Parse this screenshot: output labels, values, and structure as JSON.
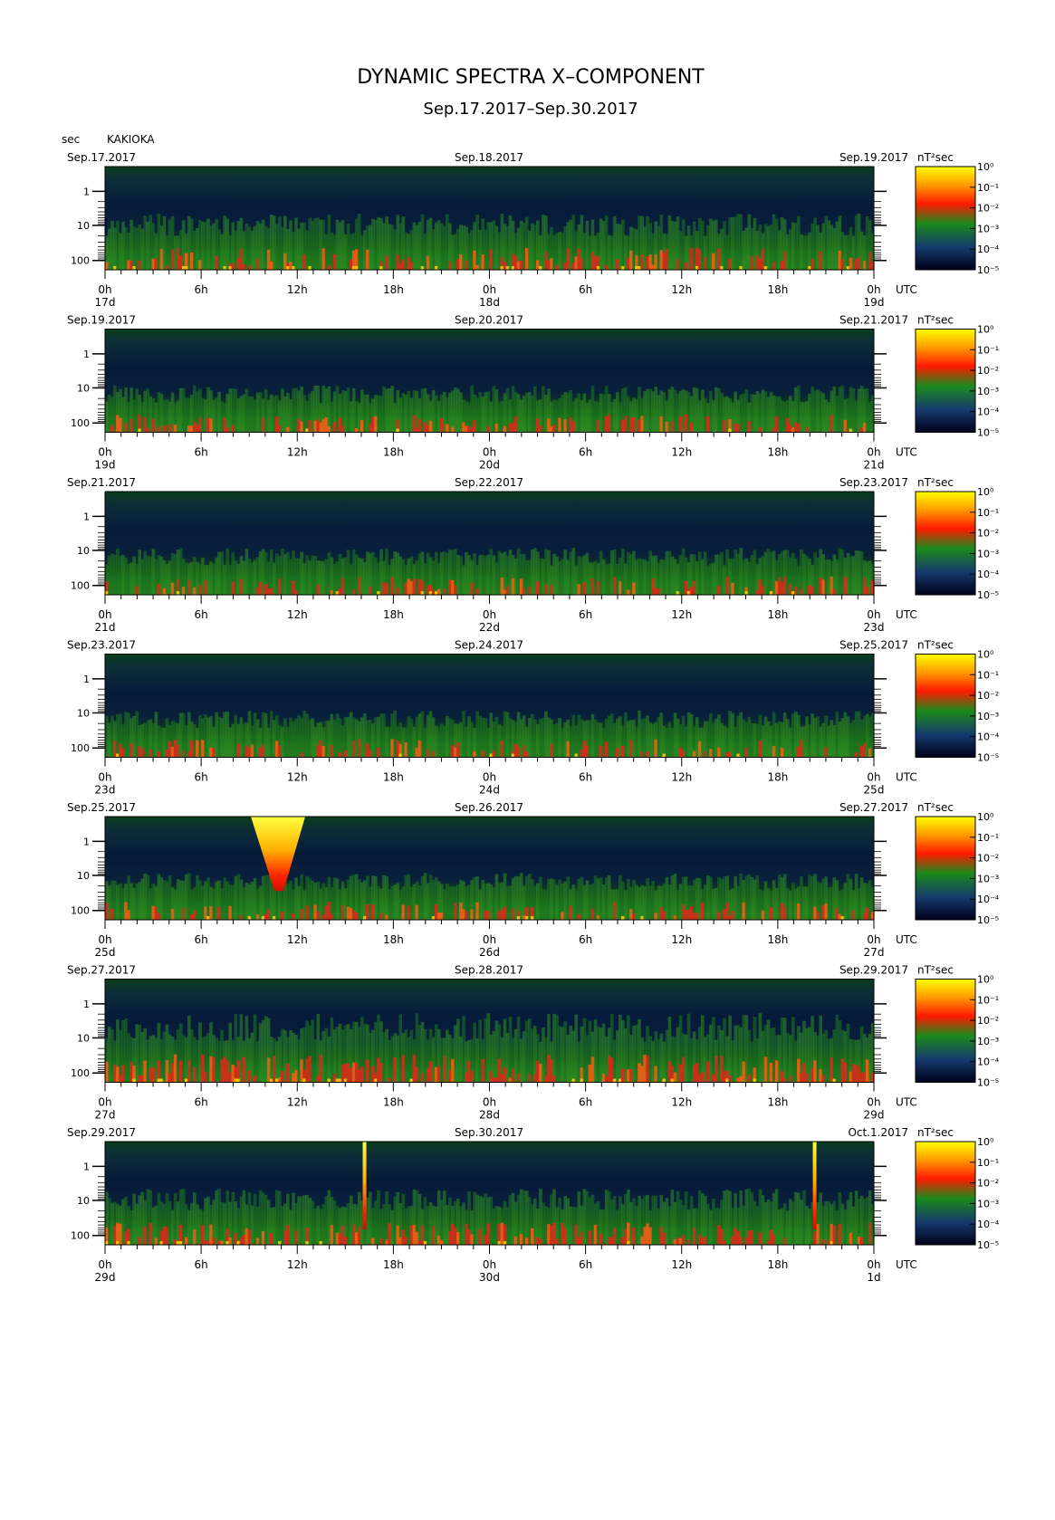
{
  "figure": {
    "title": "DYNAMIC SPECTRA X–COMPONENT",
    "subtitle": "Sep.17.2017–Sep.30.2017",
    "y_unit": "sec",
    "station": "KAKIOKA",
    "colorbar_unit": "nT²sec",
    "time_label": "UTC"
  },
  "chart_data": {
    "type": "heatmap",
    "title": "DYNAMIC SPECTRA X–COMPONENT",
    "subtitle": "Sep.17.2017–Sep.30.2017",
    "ylabel": "sec",
    "y_scale": "log",
    "y_ticks": [
      "1",
      "10",
      "100"
    ],
    "x_tick_labels": [
      "0h",
      "6h",
      "12h",
      "18h",
      "0h",
      "6h",
      "12h",
      "18h",
      "0h"
    ],
    "colorbar": {
      "unit": "nT²sec",
      "ticks": [
        "10⁰",
        "10⁻¹",
        "10⁻²",
        "10⁻³",
        "10⁻⁴",
        "10⁻⁵"
      ],
      "colors": [
        "#ffff00",
        "#ff9900",
        "#ff1a00",
        "#1b8a1b",
        "#153a6e",
        "#00001a"
      ]
    },
    "panels": [
      {
        "left_date": "Sep.17.2017",
        "mid_date": "Sep.18.2017",
        "right_date": "Sep.19.2017",
        "day_labels": [
          "17d",
          "18d",
          "19d"
        ],
        "activity": "moderate",
        "events": []
      },
      {
        "left_date": "Sep.19.2017",
        "mid_date": "Sep.20.2017",
        "right_date": "Sep.21.2017",
        "day_labels": [
          "19d",
          "20d",
          "21d"
        ],
        "activity": "low",
        "events": []
      },
      {
        "left_date": "Sep.21.2017",
        "mid_date": "Sep.22.2017",
        "right_date": "Sep.23.2017",
        "day_labels": [
          "21d",
          "22d",
          "23d"
        ],
        "activity": "low",
        "events": []
      },
      {
        "left_date": "Sep.23.2017",
        "mid_date": "Sep.24.2017",
        "right_date": "Sep.25.2017",
        "day_labels": [
          "23d",
          "24d",
          "25d"
        ],
        "activity": "low",
        "events": []
      },
      {
        "left_date": "Sep.25.2017",
        "mid_date": "Sep.26.2017",
        "right_date": "Sep.27.2017",
        "day_labels": [
          "25d",
          "26d",
          "27d"
        ],
        "activity": "low",
        "events": [
          {
            "kind": "burst",
            "hour": 10.8
          }
        ]
      },
      {
        "left_date": "Sep.27.2017",
        "mid_date": "Sep.28.2017",
        "right_date": "Sep.29.2017",
        "day_labels": [
          "27d",
          "28d",
          "29d"
        ],
        "activity": "high",
        "events": []
      },
      {
        "left_date": "Sep.29.2017",
        "mid_date": "Sep.30.2017",
        "right_date": "Oct.1.2017",
        "day_labels": [
          "29d",
          "30d",
          "1d"
        ],
        "activity": "moderate",
        "events": [
          {
            "kind": "spike",
            "hour": 16.2
          },
          {
            "kind": "spike",
            "hour": 44.3
          }
        ]
      }
    ]
  }
}
